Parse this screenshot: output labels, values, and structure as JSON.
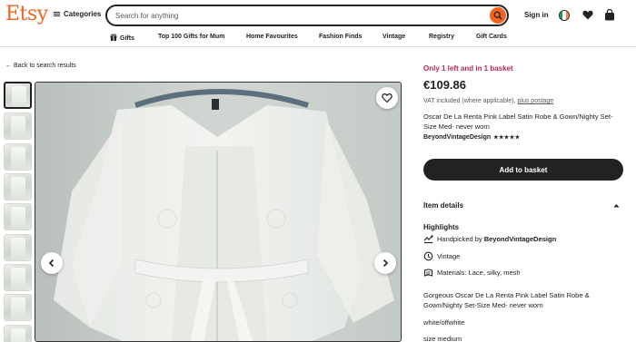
{
  "header": {
    "logo": "Etsy",
    "categories_label": "Categories",
    "search_placeholder": "Search for anything",
    "signin_label": "Sign in"
  },
  "nav": {
    "items": [
      "Gifts",
      "Top 100 Gifts for Mum",
      "Home Favourites",
      "Fashion Finds",
      "Vintage",
      "Registry",
      "Gift Cards"
    ]
  },
  "back_link": "← Back to search results",
  "listing": {
    "stock_notice": "Only 1 left and in 1 basket",
    "price": "€109.86",
    "vat_text": "VAT included (where applicable),",
    "vat_link": "plus postage",
    "title": "Oscar De La Renta Pink Label Satin Robe & Gown/Nighty Set-Size Med- never worn",
    "seller": "BeyondVintageDesign",
    "rating_stars": "★★★★★",
    "add_to_basket": "Add to basket",
    "item_details": "Item details",
    "highlights_title": "Highlights",
    "highlights": {
      "handpicked_prefix": "Handpicked by",
      "handpicked_seller": "BeyondVintageDesign",
      "vintage": "Vintage",
      "materials": "Materials: Lace, silky, mesh"
    },
    "description": "Gorgeous Oscar De La Renta Pink Label Satin Robe & Gown/Nighty Set-Size Med- never worn",
    "color_line": "white/offwhite",
    "size_line": "size medium"
  },
  "colors": {
    "brand": "#F1641E",
    "stock_alert": "#B32B55",
    "button": "#222222"
  },
  "icons": [
    "hamburger-icon",
    "search-icon",
    "flag-icon",
    "heart-icon",
    "basket-icon",
    "gift-icon",
    "favorite-heart-icon",
    "arrow-left-icon",
    "arrow-right-icon",
    "chevron-up-icon",
    "handpicked-icon",
    "vintage-icon",
    "materials-icon"
  ]
}
